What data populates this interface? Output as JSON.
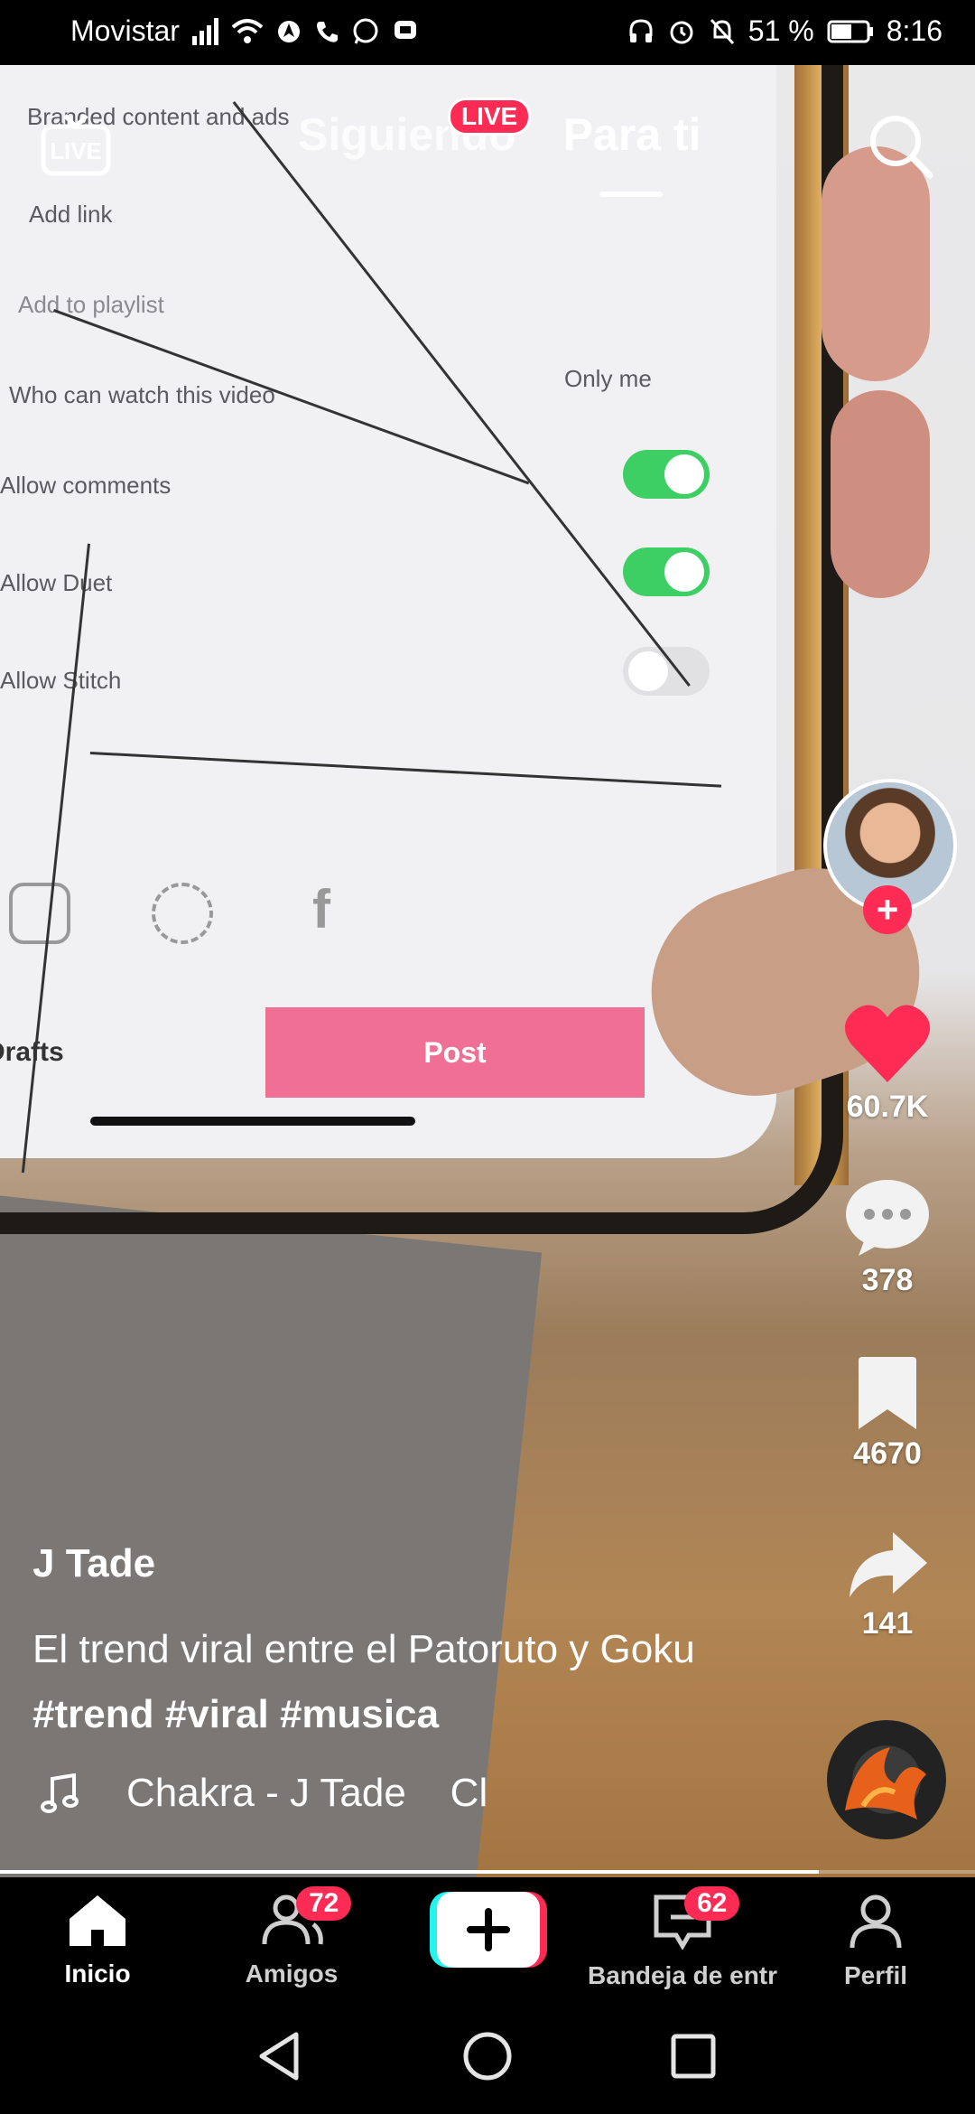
{
  "status_bar": {
    "carrier": "Movistar",
    "battery": "51 %",
    "time": "8:16"
  },
  "video_content": {
    "screen_rows": [
      "Branded content and ads",
      "Add link",
      "Add to playlist",
      "Who can watch this video",
      "Allow comments",
      "Allow Duet",
      "Allow Stitch"
    ],
    "who_value": "Only me",
    "drafts_label": "Drafts",
    "post_label": "Post"
  },
  "top_nav": {
    "live_label": "LIVE",
    "tab_following": "Siguiendo",
    "tab_foryou": "Para ti",
    "live_badge": "LIVE"
  },
  "rail": {
    "likes": "60.7K",
    "comments": "378",
    "saves": "4670",
    "shares": "141"
  },
  "post": {
    "username": "J Tade",
    "caption_text": "El trend viral entre el Patoruto y Goku ",
    "hashtags": [
      "#trend",
      "#viral",
      "#musica"
    ],
    "music": "Chakra - J Tade    Cl",
    "progress": 0.84
  },
  "bottom_nav": {
    "home": "Inicio",
    "friends": "Amigos",
    "friends_badge": "72",
    "inbox": "Bandeja de entr",
    "inbox_badge": "62",
    "profile": "Perfil"
  },
  "colors": {
    "accent": "#fe2c55",
    "toggle_on": "#3ecf64",
    "post_button": "#ef6f95"
  }
}
